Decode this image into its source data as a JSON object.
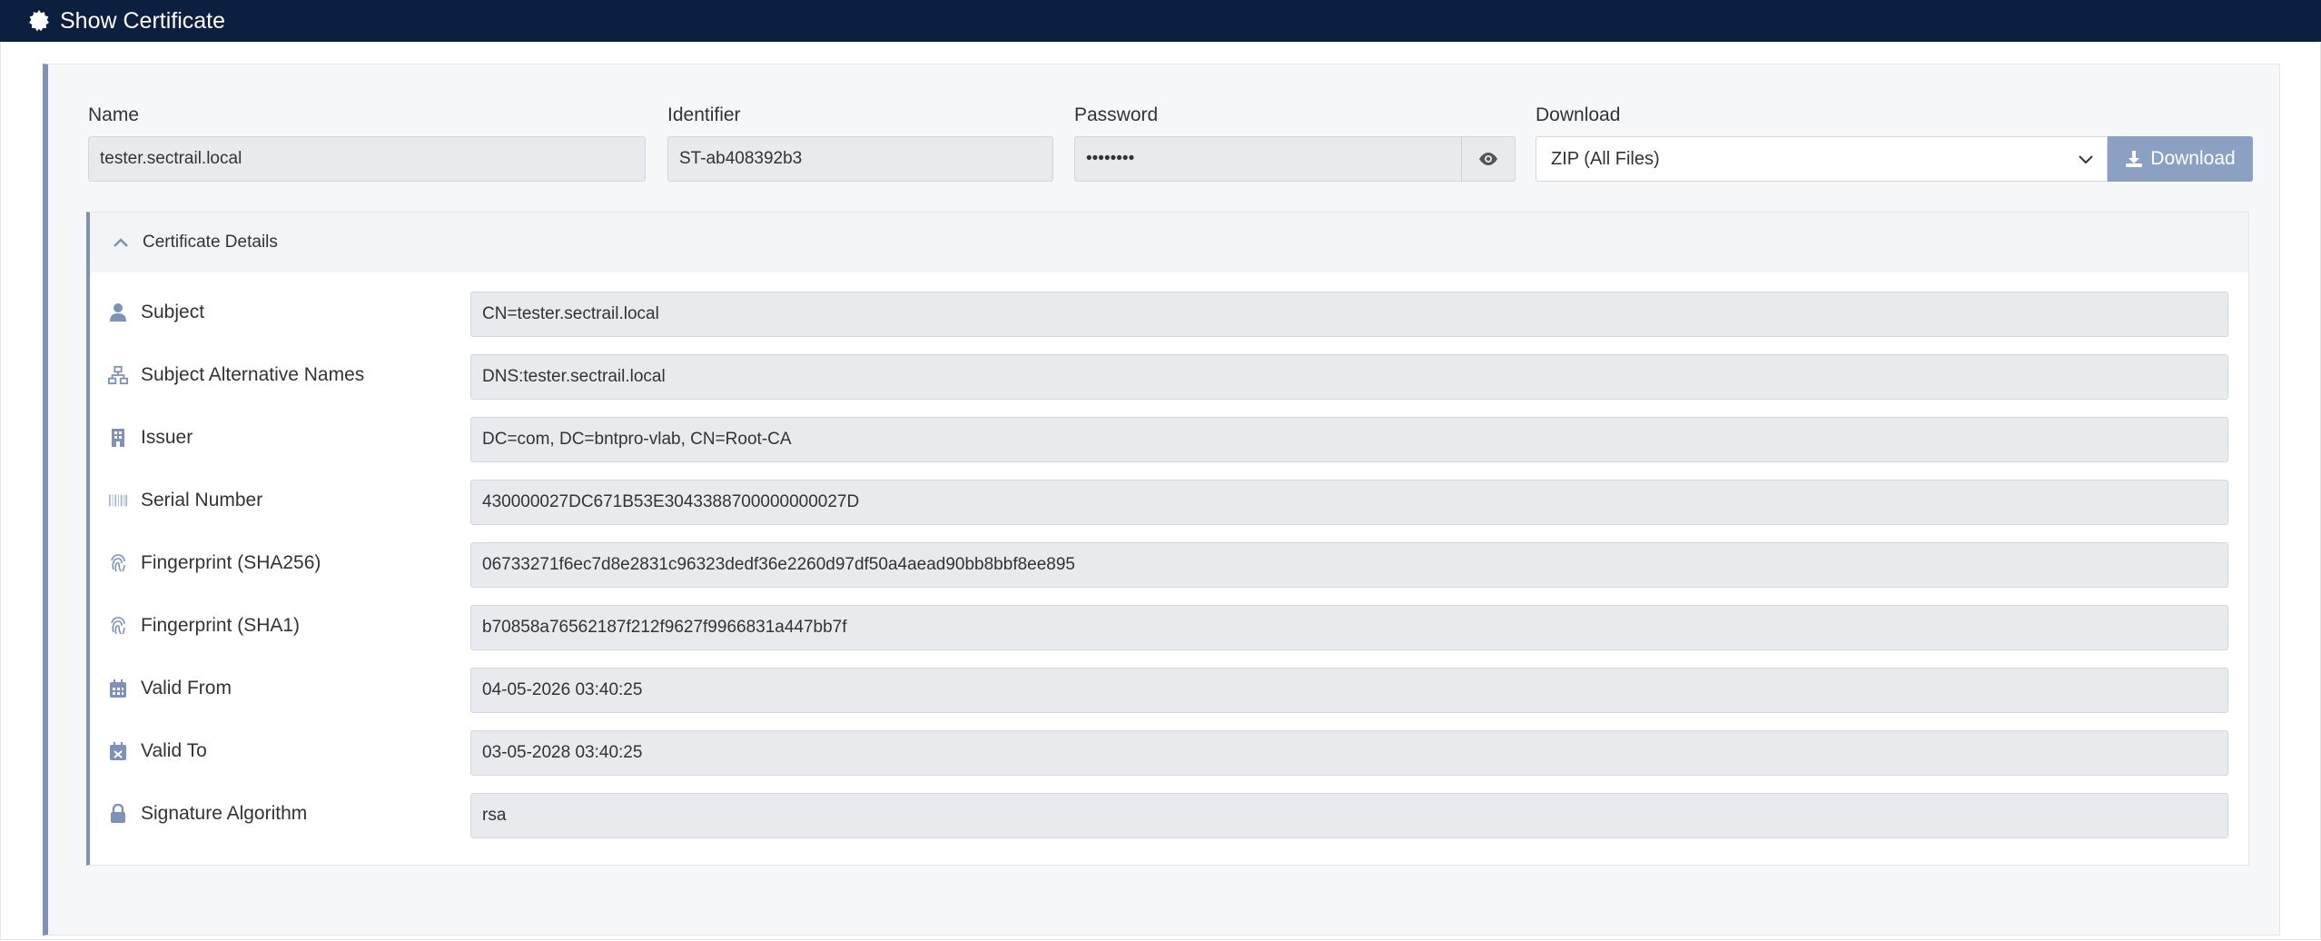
{
  "header": {
    "title": "Show Certificate"
  },
  "form": {
    "name_label": "Name",
    "name_value": "tester.sectrail.local",
    "identifier_label": "Identifier",
    "identifier_value": "ST-ab408392b3",
    "password_label": "Password",
    "password_value": "••••••••",
    "download_label": "Download",
    "download_option": "ZIP (All Files)",
    "download_button": "Download"
  },
  "details": {
    "heading": "Certificate Details",
    "rows": [
      {
        "label": "Subject",
        "value": "CN=tester.sectrail.local",
        "icon": "user-icon"
      },
      {
        "label": "Subject Alternative Names",
        "value": "DNS:tester.sectrail.local",
        "icon": "sitemap-icon"
      },
      {
        "label": "Issuer",
        "value": "DC=com, DC=bntpro-vlab, CN=Root-CA",
        "icon": "building-icon"
      },
      {
        "label": "Serial Number",
        "value": "430000027DC671B53E3043388700000000027D",
        "icon": "barcode-icon"
      },
      {
        "label": "Fingerprint (SHA256)",
        "value": "06733271f6ec7d8e2831c96323dedf36e2260d97df50a4aead90bb8bbf8ee895",
        "icon": "fingerprint-icon"
      },
      {
        "label": "Fingerprint (SHA1)",
        "value": "b70858a76562187f212f9627f9966831a447bb7f",
        "icon": "fingerprint-icon"
      },
      {
        "label": "Valid From",
        "value": "04-05-2026 03:40:25",
        "icon": "calendar-icon"
      },
      {
        "label": "Valid To",
        "value": "03-05-2028 03:40:25",
        "icon": "calendar-x-icon"
      },
      {
        "label": "Signature Algorithm",
        "value": "rsa",
        "icon": "lock-icon"
      }
    ]
  },
  "colors": {
    "titlebar": "#0c1f3f",
    "accent": "#7d92b6",
    "button": "#8ca0c4",
    "field_bg": "#e9eaed"
  }
}
